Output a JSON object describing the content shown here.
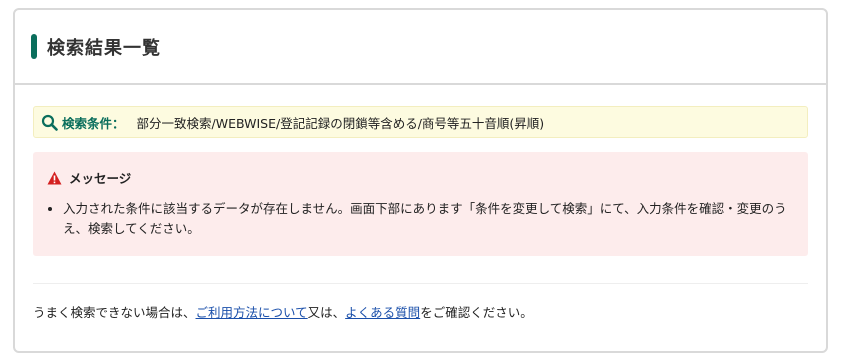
{
  "panel": {
    "title": "検索結果一覧"
  },
  "search_condition": {
    "label": "検索条件：",
    "value": "部分一致検索/WEBWISE/登記記録の閉鎖等含める/商号等五十音順(昇順)"
  },
  "message": {
    "heading": "メッセージ",
    "items": [
      "入力された条件に該当するデータが存在しません。画面下部にあります「条件を変更して検索」にて、入力条件を確認・変更のうえ、検索してください。"
    ]
  },
  "help": {
    "prefix": "うまく検索できない場合は、",
    "link1": "ご利用方法について",
    "middle": "又は、",
    "link2": "よくある質問",
    "suffix": "をご確認ください。"
  },
  "colors": {
    "accent": "#0a6e5c",
    "condition_bg": "#fdfbe0",
    "message_bg": "#fdecec",
    "warning": "#d42020",
    "link": "#1a4faa"
  }
}
